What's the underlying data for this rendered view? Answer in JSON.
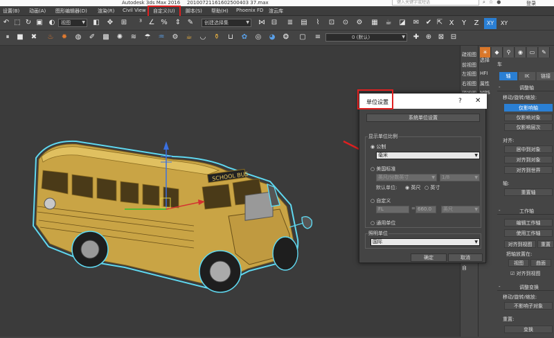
{
  "titlebar": {
    "app_title": "Autodesk 3ds Max 2016",
    "file_name": "20100721161602500403 37.max",
    "search_placeholder": "键入关键字或短语",
    "login": "登录"
  },
  "menubar": {
    "items": [
      "设置(B)",
      "动画(A)",
      "图形编辑器(D)",
      "渲染(R)",
      "Civil View",
      "自定义(U)",
      "脚本(S)",
      "帮助(H)",
      "Phoenix FD",
      "渲云库"
    ]
  },
  "toolbar": {
    "view_dropdown": "视图",
    "selection_set": "创建选择集",
    "layer_dropdown": "0 (默认)",
    "axes": [
      "X",
      "Y",
      "Z",
      "XY",
      "XY"
    ],
    "active_axis_index": 3
  },
  "viewport": {
    "bus_sign": "SCHOOL BUS"
  },
  "right_strip": {
    "items": [
      "疏视图",
      "前视图",
      "左视图",
      "右视图",
      "顶视图",
      "剪",
      "描",
      "瑞",
      "测",
      "铃",
      "修",
      "建",
      "摄",
      "碰",
      "差",
      "设",
      "设",
      "锁",
      "选",
      "跟",
      "遮",
      "自",
      "自"
    ],
    "side_labels": [
      "选择",
      "HFI",
      "属性",
      "MPS"
    ]
  },
  "command_panel": {
    "object_name": "车",
    "subtabs": [
      "轴",
      "IK",
      "链接"
    ],
    "active_subtab": 0,
    "adjust_axis_header": "调整轴",
    "move_rotate_label": "移动/旋转/缩放:",
    "affect_buttons": [
      "仅影响轴",
      "仅影响对象",
      "仅影响层次"
    ],
    "align_label": "对齐:",
    "align_buttons": [
      "居中到对象",
      "对齐到对象",
      "对齐到世界"
    ],
    "axis_label": "轴:",
    "reset_axis": "重置轴",
    "working_axis_header": "工作轴",
    "working_buttons": [
      "编辑工作轴",
      "使用工作轴",
      "对齐到视图",
      "重置"
    ],
    "place_axis_label": "把轴放置在:",
    "place_buttons": [
      "视图",
      "曲面"
    ],
    "align_view_check": "对齐到视图",
    "adjust_transform_header": "调整变换",
    "transform_label": "移动/旋转/缩放:",
    "no_child": "不影响子对象",
    "reset_label": "重置:",
    "transform_button": "变换"
  },
  "dialog": {
    "title": "单位设置",
    "help": "?",
    "close": "✕",
    "system_units_button": "系统单位设置",
    "display_group": "显示单位比例",
    "metric_label": "公制",
    "metric_value": "毫米",
    "us_label": "美国标准",
    "us_value": "英尺/分数英寸",
    "fraction_value": "1/8",
    "default_units_label": "默认单位:",
    "feet_label": "英尺",
    "inches_label": "英寸",
    "custom_label": "自定义",
    "custom_name": "FL",
    "custom_equals": "=",
    "custom_value": "660.0",
    "custom_unit": "英尺",
    "generic_label": "通用单位",
    "lighting_group": "照明单位",
    "lighting_value": "国际",
    "ok": "确定",
    "cancel": "取消"
  },
  "colors": {
    "accent": "#2a7fd4",
    "highlight": "#e02020",
    "tab_active": "#d9772a"
  }
}
